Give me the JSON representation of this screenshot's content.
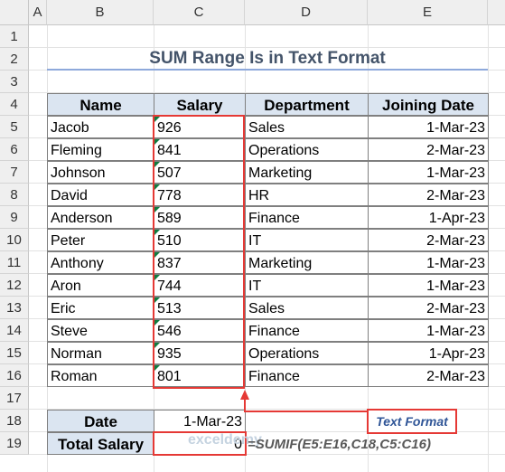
{
  "columns": [
    "A",
    "B",
    "C",
    "D",
    "E"
  ],
  "rows": [
    "1",
    "2",
    "3",
    "4",
    "5",
    "6",
    "7",
    "8",
    "9",
    "10",
    "11",
    "12",
    "13",
    "14",
    "15",
    "16",
    "17",
    "18",
    "19"
  ],
  "title": "SUM Range Is in Text Format",
  "table": {
    "headers": [
      "Name",
      "Salary",
      "Department",
      "Joining Date"
    ],
    "rows": [
      [
        "Jacob",
        "926",
        "Sales",
        "1-Mar-23"
      ],
      [
        "Fleming",
        "841",
        "Operations",
        "2-Mar-23"
      ],
      [
        "Johnson",
        "507",
        "Marketing",
        "1-Mar-23"
      ],
      [
        "David",
        "778",
        "HR",
        "2-Mar-23"
      ],
      [
        "Anderson",
        "589",
        "Finance",
        "1-Apr-23"
      ],
      [
        "Peter",
        "510",
        "IT",
        "2-Mar-23"
      ],
      [
        "Anthony",
        "837",
        "Marketing",
        "1-Mar-23"
      ],
      [
        "Aron",
        "744",
        "IT",
        "1-Mar-23"
      ],
      [
        "Eric",
        "513",
        "Sales",
        "2-Mar-23"
      ],
      [
        "Steve",
        "546",
        "Finance",
        "1-Mar-23"
      ],
      [
        "Norman",
        "935",
        "Operations",
        "1-Apr-23"
      ],
      [
        "Roman",
        "801",
        "Finance",
        "2-Mar-23"
      ]
    ]
  },
  "summary": {
    "date_label": "Date",
    "date_value": "1-Mar-23",
    "total_label": "Total Salary",
    "total_value": "0"
  },
  "annotation": "Text Format",
  "formula": "=SUMIF(E5:E16,C18,C5:C16)",
  "watermark": "exceldemy",
  "colors": {
    "header_fill": "#dbe5f1",
    "highlight": "#e53935",
    "title": "#44546a",
    "annotation": "#2f5597"
  }
}
